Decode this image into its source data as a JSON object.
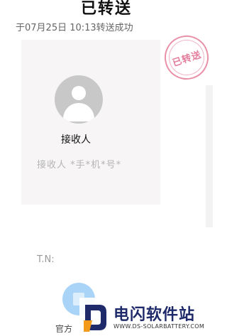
{
  "header": {
    "title": "已转送",
    "subtitle": "于07月25日 10:13转送成功"
  },
  "stamp": {
    "text": "已转送",
    "color": "#e47c9c"
  },
  "receiver": {
    "label": "接收人",
    "phone": "接收人 *手*机*号*"
  },
  "transfer": {
    "tn_label": "T.N:"
  },
  "footer": {
    "official_label": "官方",
    "icon": "wallet-icon"
  },
  "watermark": {
    "title": "电闪软件站",
    "url": "WWW.DS-SOLARBATTERY.COM",
    "logo_colors": [
      "#1f2a6b",
      "#f39a1b"
    ]
  }
}
